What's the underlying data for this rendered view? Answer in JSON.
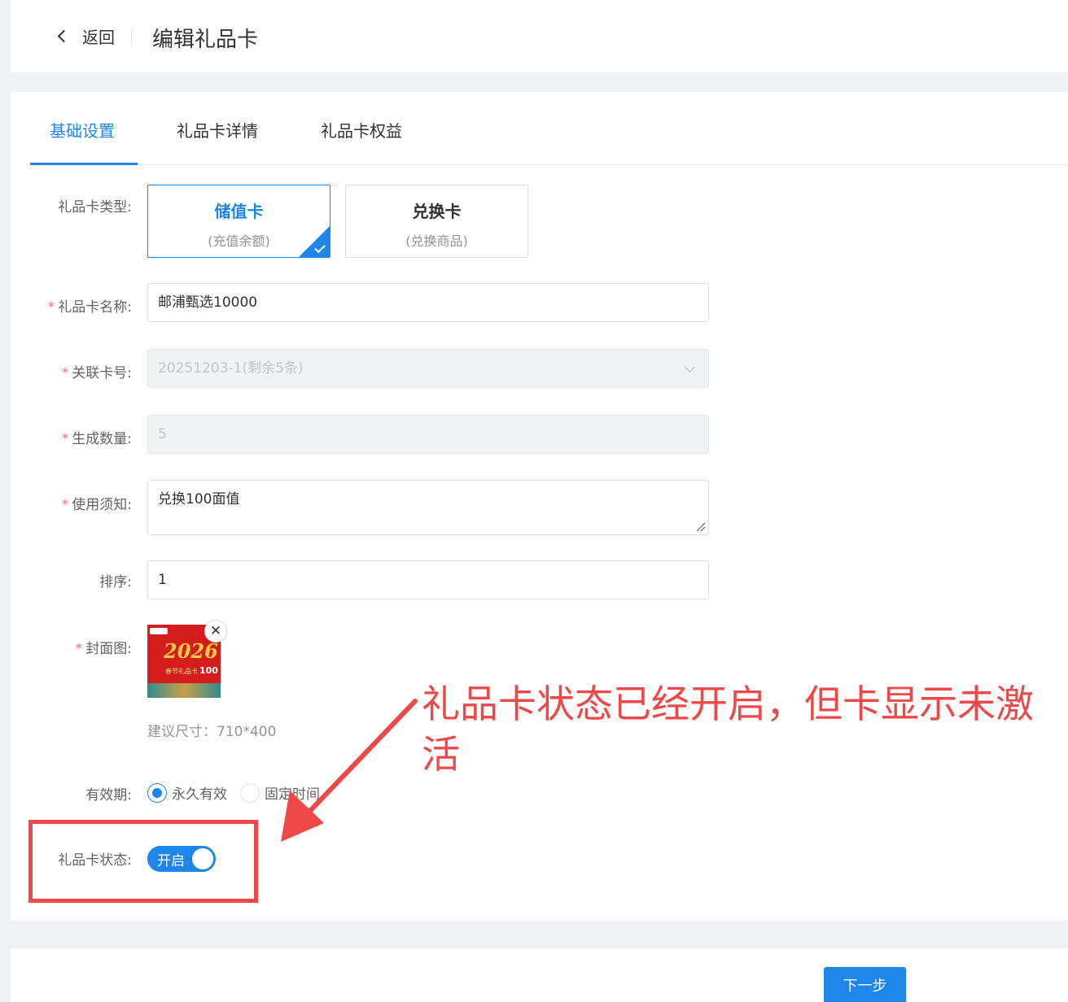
{
  "header": {
    "back_label": "返回",
    "title": "编辑礼品卡"
  },
  "tabs": [
    {
      "label": "基础设置",
      "active": true
    },
    {
      "label": "礼品卡详情",
      "active": false
    },
    {
      "label": "礼品卡权益",
      "active": false
    }
  ],
  "form": {
    "type": {
      "label": "礼品卡类型:",
      "options": [
        {
          "title": "储值卡",
          "desc": "(充值余额)",
          "selected": true
        },
        {
          "title": "兑换卡",
          "desc": "(兑换商品)",
          "selected": false
        }
      ]
    },
    "name": {
      "label": "礼品卡名称:",
      "required": "*",
      "value": "邮浦甄选10000"
    },
    "card_no": {
      "label": "关联卡号:",
      "required": "*",
      "value": "20251203-1(剩余5条)"
    },
    "quantity": {
      "label": "生成数量:",
      "required": "*",
      "value": "5"
    },
    "notice": {
      "label": "使用须知:",
      "required": "*",
      "value": "兑换100面值"
    },
    "sort": {
      "label": "排序:",
      "value": "1"
    },
    "cover": {
      "label": "封面图:",
      "required": "*",
      "hint": "建议尺寸：710*400",
      "image": {
        "year": "2026",
        "sub": "春节礼品卡",
        "value": "100"
      },
      "close_glyph": "✕"
    },
    "validity": {
      "label": "有效期:",
      "options": [
        {
          "label": "永久有效",
          "selected": true
        },
        {
          "label": "固定时间",
          "selected": false
        }
      ]
    },
    "status": {
      "label": "礼品卡状态:",
      "switch_text": "开启",
      "on": true
    }
  },
  "annotation": {
    "text": "礼品卡状态已经开启，但卡显示未激活",
    "color": "#ef4848"
  },
  "footer": {
    "next_label": "下一步"
  },
  "colors": {
    "primary": "#1e86e8",
    "required": "#f56c6c"
  }
}
